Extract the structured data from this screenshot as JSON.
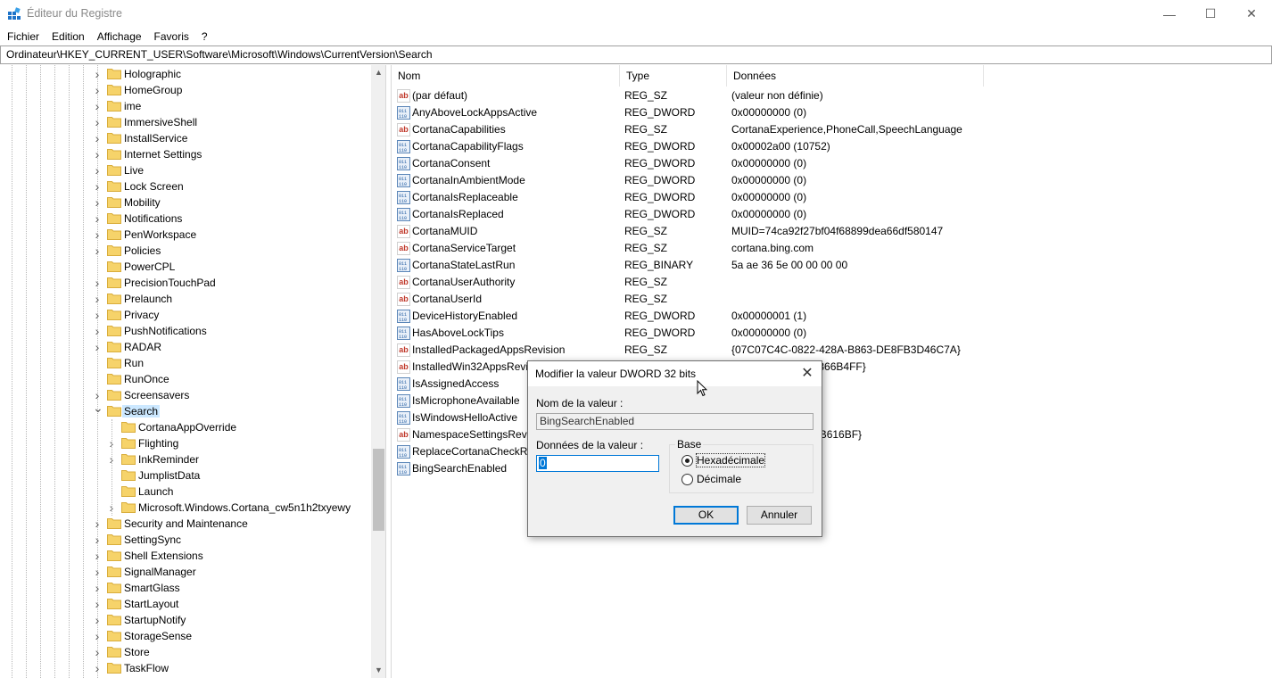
{
  "window": {
    "title": "Éditeur du Registre",
    "min_glyph": "—",
    "max_glyph": "☐",
    "close_glyph": "✕"
  },
  "menu": [
    "Fichier",
    "Edition",
    "Affichage",
    "Favoris",
    "?"
  ],
  "address": "Ordinateur\\HKEY_CURRENT_USER\\Software\\Microsoft\\Windows\\CurrentVersion\\Search",
  "tree": [
    {
      "label": "Holographic",
      "level": 0,
      "expander": "collapsed"
    },
    {
      "label": "HomeGroup",
      "level": 0,
      "expander": "collapsed"
    },
    {
      "label": "ime",
      "level": 0,
      "expander": "collapsed"
    },
    {
      "label": "ImmersiveShell",
      "level": 0,
      "expander": "collapsed"
    },
    {
      "label": "InstallService",
      "level": 0,
      "expander": "collapsed"
    },
    {
      "label": "Internet Settings",
      "level": 0,
      "expander": "collapsed"
    },
    {
      "label": "Live",
      "level": 0,
      "expander": "collapsed"
    },
    {
      "label": "Lock Screen",
      "level": 0,
      "expander": "collapsed"
    },
    {
      "label": "Mobility",
      "level": 0,
      "expander": "collapsed"
    },
    {
      "label": "Notifications",
      "level": 0,
      "expander": "collapsed"
    },
    {
      "label": "PenWorkspace",
      "level": 0,
      "expander": "collapsed"
    },
    {
      "label": "Policies",
      "level": 0,
      "expander": "collapsed"
    },
    {
      "label": "PowerCPL",
      "level": 0,
      "expander": "none"
    },
    {
      "label": "PrecisionTouchPad",
      "level": 0,
      "expander": "collapsed"
    },
    {
      "label": "Prelaunch",
      "level": 0,
      "expander": "collapsed"
    },
    {
      "label": "Privacy",
      "level": 0,
      "expander": "collapsed"
    },
    {
      "label": "PushNotifications",
      "level": 0,
      "expander": "collapsed"
    },
    {
      "label": "RADAR",
      "level": 0,
      "expander": "collapsed"
    },
    {
      "label": "Run",
      "level": 0,
      "expander": "none"
    },
    {
      "label": "RunOnce",
      "level": 0,
      "expander": "none"
    },
    {
      "label": "Screensavers",
      "level": 0,
      "expander": "collapsed"
    },
    {
      "label": "Search",
      "level": 0,
      "expander": "expanded",
      "selected": true
    },
    {
      "label": "CortanaAppOverride",
      "level": 1,
      "expander": "none"
    },
    {
      "label": "Flighting",
      "level": 1,
      "expander": "collapsed"
    },
    {
      "label": "InkReminder",
      "level": 1,
      "expander": "collapsed"
    },
    {
      "label": "JumplistData",
      "level": 1,
      "expander": "none"
    },
    {
      "label": "Launch",
      "level": 1,
      "expander": "none"
    },
    {
      "label": "Microsoft.Windows.Cortana_cw5n1h2txyewy",
      "level": 1,
      "expander": "collapsed"
    },
    {
      "label": "Security and Maintenance",
      "level": 0,
      "expander": "collapsed"
    },
    {
      "label": "SettingSync",
      "level": 0,
      "expander": "collapsed"
    },
    {
      "label": "Shell Extensions",
      "level": 0,
      "expander": "collapsed"
    },
    {
      "label": "SignalManager",
      "level": 0,
      "expander": "collapsed"
    },
    {
      "label": "SmartGlass",
      "level": 0,
      "expander": "collapsed"
    },
    {
      "label": "StartLayout",
      "level": 0,
      "expander": "collapsed"
    },
    {
      "label": "StartupNotify",
      "level": 0,
      "expander": "collapsed"
    },
    {
      "label": "StorageSense",
      "level": 0,
      "expander": "collapsed"
    },
    {
      "label": "Store",
      "level": 0,
      "expander": "collapsed"
    },
    {
      "label": "TaskFlow",
      "level": 0,
      "expander": "collapsed"
    }
  ],
  "columns": {
    "name": "Nom",
    "type": "Type",
    "data": "Données"
  },
  "values": [
    {
      "name": "(par défaut)",
      "type": "REG_SZ",
      "data": "(valeur non définie)",
      "icon": "ab"
    },
    {
      "name": "AnyAboveLockAppsActive",
      "type": "REG_DWORD",
      "data": "0x00000000 (0)",
      "icon": "bin"
    },
    {
      "name": "CortanaCapabilities",
      "type": "REG_SZ",
      "data": "CortanaExperience,PhoneCall,SpeechLanguage",
      "icon": "ab"
    },
    {
      "name": "CortanaCapabilityFlags",
      "type": "REG_DWORD",
      "data": "0x00002a00 (10752)",
      "icon": "bin"
    },
    {
      "name": "CortanaConsent",
      "type": "REG_DWORD",
      "data": "0x00000000 (0)",
      "icon": "bin"
    },
    {
      "name": "CortanaInAmbientMode",
      "type": "REG_DWORD",
      "data": "0x00000000 (0)",
      "icon": "bin"
    },
    {
      "name": "CortanaIsReplaceable",
      "type": "REG_DWORD",
      "data": "0x00000000 (0)",
      "icon": "bin"
    },
    {
      "name": "CortanaIsReplaced",
      "type": "REG_DWORD",
      "data": "0x00000000 (0)",
      "icon": "bin"
    },
    {
      "name": "CortanaMUID",
      "type": "REG_SZ",
      "data": "MUID=74ca92f27bf04f68899dea66df580147",
      "icon": "ab"
    },
    {
      "name": "CortanaServiceTarget",
      "type": "REG_SZ",
      "data": "cortana.bing.com",
      "icon": "ab"
    },
    {
      "name": "CortanaStateLastRun",
      "type": "REG_BINARY",
      "data": "5a ae 36 5e 00 00 00 00",
      "icon": "bin"
    },
    {
      "name": "CortanaUserAuthority",
      "type": "REG_SZ",
      "data": "",
      "icon": "ab"
    },
    {
      "name": "CortanaUserId",
      "type": "REG_SZ",
      "data": "",
      "icon": "ab"
    },
    {
      "name": "DeviceHistoryEnabled",
      "type": "REG_DWORD",
      "data": "0x00000001 (1)",
      "icon": "bin"
    },
    {
      "name": "HasAboveLockTips",
      "type": "REG_DWORD",
      "data": "0x00000000 (0)",
      "icon": "bin"
    },
    {
      "name": "InstalledPackagedAppsRevision",
      "type": "REG_SZ",
      "data": "{07C07C4C-0822-428A-B863-DE8FB3D46C7A}",
      "icon": "ab"
    },
    {
      "name": "InstalledWin32AppsRevis",
      "type": "",
      "data": "7A5-ACD5-EE189366B4FF}",
      "icon": "ab"
    },
    {
      "name": "IsAssignedAccess",
      "type": "",
      "data": "",
      "icon": "bin"
    },
    {
      "name": "IsMicrophoneAvailable",
      "type": "",
      "data": "",
      "icon": "bin"
    },
    {
      "name": "IsWindowsHelloActive",
      "type": "",
      "data": "",
      "icon": "bin"
    },
    {
      "name": "NamespaceSettingsRevis",
      "type": "",
      "data": "72-B6CC-8EAD4FB616BF}",
      "icon": "ab"
    },
    {
      "name": "ReplaceCortanaCheckRe",
      "type": "",
      "data": "",
      "icon": "bin"
    },
    {
      "name": "BingSearchEnabled",
      "type": "",
      "data": "",
      "icon": "bin",
      "selected": true
    }
  ],
  "dialog": {
    "title": "Modifier la valeur DWORD 32 bits",
    "name_label": "Nom de la valeur :",
    "name_value": "BingSearchEnabled",
    "data_label": "Données de la valeur :",
    "data_value": "0",
    "base_label": "Base",
    "hex_label": "Hexadécimale",
    "dec_label": "Décimale",
    "selected_base": "hex",
    "ok": "OK",
    "cancel": "Annuler",
    "close_glyph": "✕"
  },
  "colors": {
    "selection": "#cce8ff",
    "accent": "#0078d7",
    "folder": "#f6d36a"
  }
}
